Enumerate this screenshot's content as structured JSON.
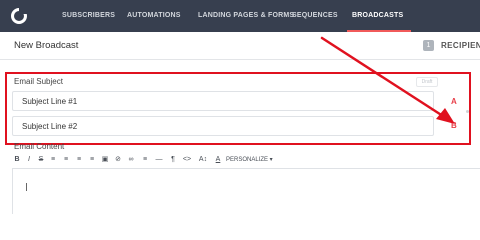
{
  "nav": {
    "items": [
      {
        "label": "SUBSCRIBERS"
      },
      {
        "label": "AUTOMATIONS"
      },
      {
        "label": "LANDING PAGES & FORMS"
      },
      {
        "label": "SEQUENCES"
      },
      {
        "label": "BROADCASTS",
        "active": true
      }
    ],
    "active_color": "#f15a5a",
    "bg_color": "#373f4f"
  },
  "header": {
    "title": "New Broadcast",
    "recipient_count": "1",
    "recipients_label": "RECIPIENTS"
  },
  "subject": {
    "label": "Email Subject",
    "badge": "Draft",
    "lines": [
      {
        "value": "Subject Line #1",
        "variant": "A"
      },
      {
        "value": "Subject Line #2",
        "variant": "B"
      }
    ]
  },
  "content": {
    "label": "Email Content",
    "toolbar": {
      "icons": [
        "bold-icon",
        "italic-icon",
        "strikethrough-icon",
        "bullet-list-icon",
        "numbered-list-icon",
        "align-left-icon",
        "align-center-icon",
        "image-icon",
        "link-icon",
        "unlink-icon",
        "align-justify-icon",
        "horizontal-rule-icon",
        "pilcrow-icon",
        "code-icon",
        "text-size-icon",
        "text-color-icon"
      ],
      "glyphs": [
        "B",
        "I",
        "S",
        "≡",
        "≡",
        "≡",
        "≡",
        "▣",
        "⊘",
        "∞",
        "≡",
        "—",
        "¶",
        "<>",
        "A↕",
        "A"
      ],
      "personalize_label": "PERSONALIZE ▾"
    }
  },
  "annotation": {
    "highlight_color": "#e0111f"
  }
}
